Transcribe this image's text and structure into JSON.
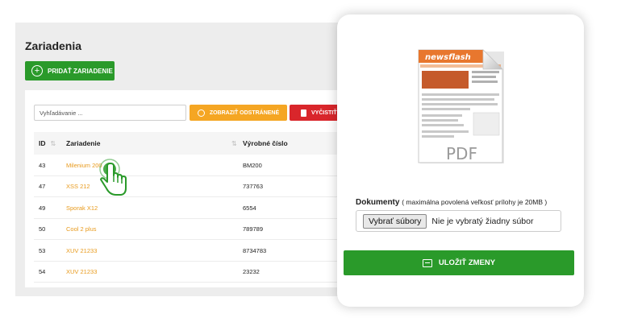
{
  "page": {
    "title": "Zariadenia",
    "add_button": "PRIDAŤ ZARIADENIE"
  },
  "toolbar": {
    "search_placeholder": "Vyhľadávanie ...",
    "show_removed": "ZOBRAZIŤ ODSTRÁNENÉ",
    "clear": "VYČISTIŤ"
  },
  "table": {
    "headers": {
      "id": "ID",
      "device": "Zariadenie",
      "serial": "Výrobné číslo"
    },
    "rows": [
      {
        "id": "43",
        "device": "Milenium 200",
        "serial": "BM200"
      },
      {
        "id": "47",
        "device": "XSS 212",
        "serial": "737763"
      },
      {
        "id": "49",
        "device": "Sporak X12",
        "serial": "6554"
      },
      {
        "id": "50",
        "device": "Cool 2 plus",
        "serial": "789789"
      },
      {
        "id": "53",
        "device": "XUV 21233",
        "serial": "8734783"
      },
      {
        "id": "54",
        "device": "XUV 21233",
        "serial": "23232"
      }
    ]
  },
  "modal": {
    "preview_banner": "newsflash",
    "preview_label": "PDF",
    "documents_label": "Dokumenty",
    "documents_hint": "( maximálna povolená veľkosť prílohy je 20MB )",
    "choose_files": "Vybrať súbory",
    "no_file": "Nie je vybratý žiadny súbor",
    "save_button": "ULOŽIŤ ZMENY"
  },
  "colors": {
    "green": "#2a9a2a",
    "orange": "#f5a623",
    "red": "#d9262b",
    "link": "#e89a1c"
  },
  "icons": {
    "add": "plus-circle-icon",
    "show_removed": "refresh-icon",
    "clear": "trash-icon",
    "sort": "sort-icon",
    "cursor": "hand-pointer-icon",
    "save": "archive-icon",
    "file": "pdf-file-icon"
  }
}
